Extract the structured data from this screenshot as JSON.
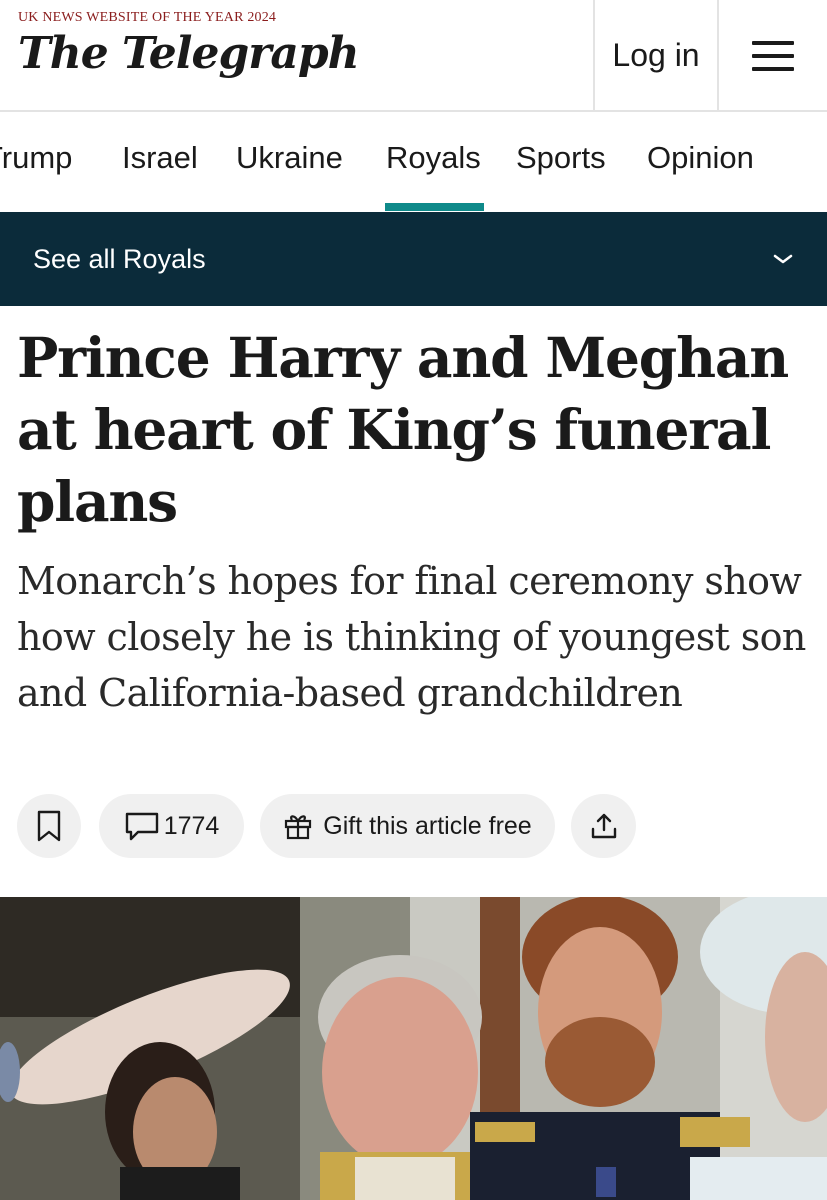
{
  "header": {
    "tagline": "UK NEWS WEBSITE OF THE YEAR 2024",
    "logo": "The Telegraph",
    "login_label": "Log in",
    "menu_icon": "hamburger-menu-icon"
  },
  "nav": {
    "items": [
      "Trump",
      "Israel",
      "Ukraine",
      "Royals",
      "Sports",
      "Opinion"
    ],
    "active": "Royals",
    "accent_color": "#0f8a8a"
  },
  "section": {
    "label": "See all Royals",
    "background": "#0b2b3a",
    "icon": "chevron-down-icon"
  },
  "article": {
    "headline": "Prince Harry and Meghan at heart of King’s funeral plans",
    "standfirst": "Monarch’s hopes for final ceremony show how closely he is thinking of youngest son and California-based grandchildren"
  },
  "actions": {
    "bookmark_icon": "bookmark-icon",
    "comment_icon": "comment-icon",
    "comment_count": "1774",
    "gift_icon": "gift-icon",
    "gift_label": "Gift this article free",
    "share_icon": "share-icon"
  },
  "photo": {
    "subject": "royal-family-balcony-photo"
  }
}
